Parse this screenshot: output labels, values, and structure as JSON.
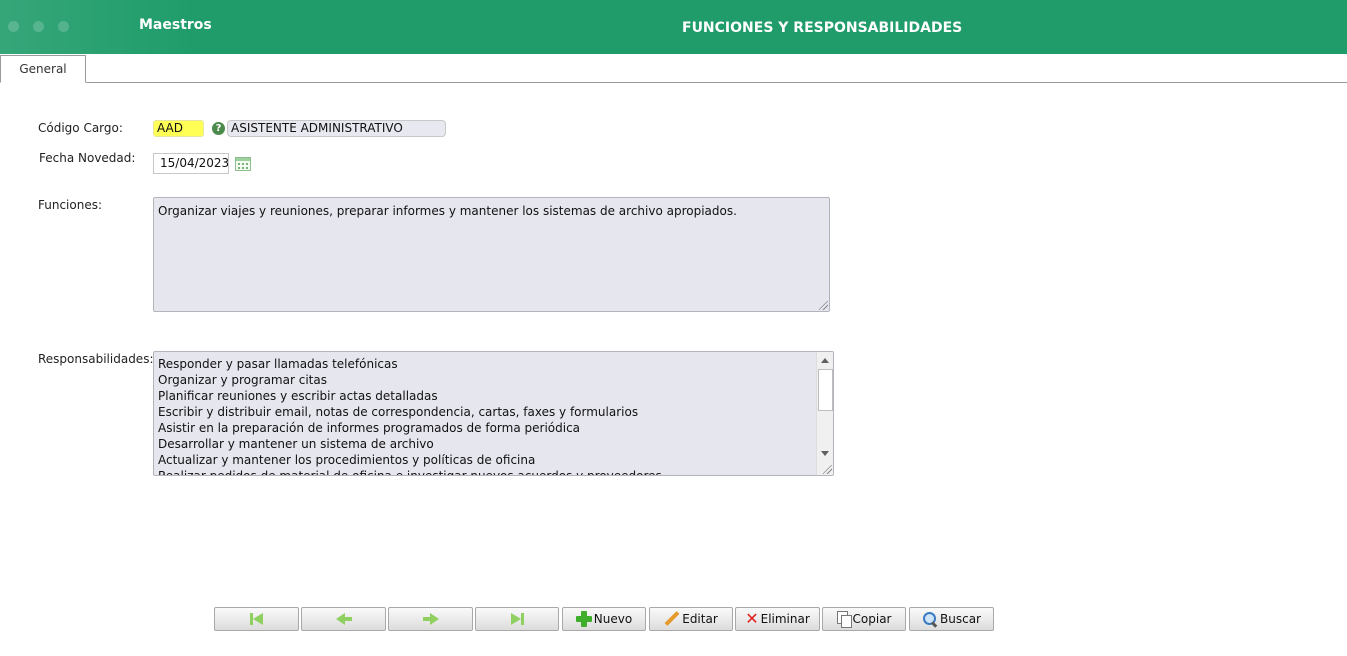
{
  "header": {
    "app_name": "Maestros",
    "title": "FUNCIONES Y RESPONSABILIDADES",
    "accent_color": "#1f9c6a"
  },
  "tabs": [
    {
      "label": "General",
      "active": true
    }
  ],
  "form": {
    "codigo_cargo": {
      "label": "Código Cargo:",
      "code_value": "AAD",
      "name_value": "ASISTENTE ADMINISTRATIVO",
      "code_highlight_color": "#ffff55",
      "icon": "help-icon"
    },
    "fecha_novedad": {
      "label": "Fecha Novedad:",
      "value": "15/04/2023",
      "icon": "calendar-icon"
    },
    "funciones": {
      "label": "Funciones:",
      "value": "Organizar viajes y reuniones, preparar informes y mantener los sistemas de archivo apropiados."
    },
    "responsabilidades": {
      "label": "Responsabilidades:",
      "lines": [
        "Responder y pasar llamadas telefónicas",
        "Organizar y programar citas",
        "Planificar reuniones y escribir actas detalladas",
        "Escribir y distribuir email, notas de correspondencia, cartas, faxes y formularios",
        "Asistir en la preparación de informes programados de forma periódica",
        "Desarrollar y mantener un sistema de archivo",
        "Actualizar y mantener los procedimientos y políticas de oficina",
        "Realizar pedidos de material de oficina e investigar nuevos acuerdos y proveedores"
      ]
    }
  },
  "toolbar": {
    "first_icon": "first-record-icon",
    "prev_icon": "previous-record-icon",
    "next_icon": "next-record-icon",
    "last_icon": "last-record-icon",
    "nuevo": "Nuevo",
    "editar": "Editar",
    "eliminar": "Eliminar",
    "copiar": "Copiar",
    "buscar": "Buscar"
  }
}
